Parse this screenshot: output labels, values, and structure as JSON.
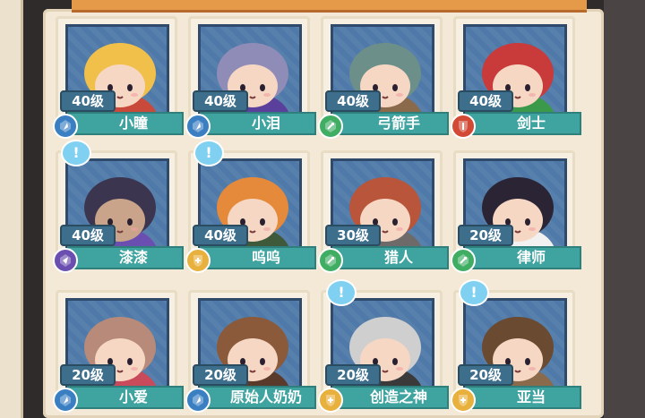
{
  "characters": [
    {
      "name": "小瞳",
      "level": "40级",
      "class_icon": "mage",
      "icon_color": "#3a7fc2",
      "hair": "#f1c04a",
      "skin": "#f6d7c4",
      "accent": "#c94a3a",
      "bubble": false
    },
    {
      "name": "小泪",
      "level": "40级",
      "class_icon": "mage",
      "icon_color": "#3a7fc2",
      "hair": "#8f8cb8",
      "skin": "#f6d7c4",
      "accent": "#5a3f9c",
      "bubble": false
    },
    {
      "name": "弓箭手",
      "level": "40级",
      "class_icon": "ranger",
      "icon_color": "#3fae63",
      "hair": "#6d8f8a",
      "skin": "#f6d7c4",
      "accent": "#8a6a4a",
      "bubble": false
    },
    {
      "name": "剑士",
      "level": "40级",
      "class_icon": "warrior",
      "icon_color": "#d24a35",
      "hair": "#c93a3a",
      "skin": "#f6d7c4",
      "accent": "#3a9a4a",
      "bubble": false
    },
    {
      "name": "漆漆",
      "level": "40级",
      "class_icon": "assassin",
      "icon_color": "#6b4fb0",
      "hair": "#3b3550",
      "skin": "#c9a48a",
      "accent": "#6b4fb0",
      "bubble": true
    },
    {
      "name": "呜呜",
      "level": "40级",
      "class_icon": "support",
      "icon_color": "#e8b03c",
      "hair": "#e48a3a",
      "skin": "#f6d7c4",
      "accent": "#3e5a3a",
      "bubble": true
    },
    {
      "name": "猎人",
      "level": "30级",
      "class_icon": "ranger",
      "icon_color": "#3fae63",
      "hair": "#b8553a",
      "skin": "#f6d7c4",
      "accent": "#6f6a6a",
      "bubble": false
    },
    {
      "name": "律师",
      "level": "20级",
      "class_icon": "ranger",
      "icon_color": "#3fae63",
      "hair": "#2a2434",
      "skin": "#f6d7c4",
      "accent": "#f1f1f1",
      "bubble": false
    },
    {
      "name": "小爱",
      "level": "20级",
      "class_icon": "mage",
      "icon_color": "#3a7fc2",
      "hair": "#b88a7a",
      "skin": "#f6d7c4",
      "accent": "#c94a5a",
      "bubble": false
    },
    {
      "name": "原始人奶奶",
      "level": "20级",
      "class_icon": "mage",
      "icon_color": "#3a7fc2",
      "hair": "#8a5a3a",
      "skin": "#f6d7c4",
      "accent": "#5a3a2a",
      "bubble": false
    },
    {
      "name": "创造之神",
      "level": "20级",
      "class_icon": "support",
      "icon_color": "#e8b03c",
      "hair": "#cfcfcf",
      "skin": "#f6d7c4",
      "accent": "#3a3a3a",
      "bubble": true
    },
    {
      "name": "亚当",
      "level": "20级",
      "class_icon": "support",
      "icon_color": "#e8b03c",
      "hair": "#6a4a30",
      "skin": "#f6d7c4",
      "accent": "#8a6a4a",
      "bubble": true
    }
  ],
  "bubble_symbol": "!"
}
